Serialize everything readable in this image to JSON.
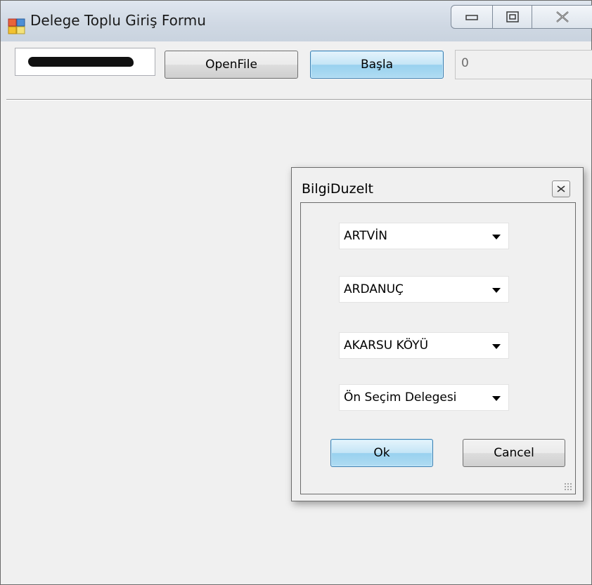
{
  "window": {
    "title": "Delege Toplu Giriş Formu",
    "icons": {
      "app": "form-app-icon",
      "minimize": "minimize-icon",
      "maximize": "maximize-icon",
      "close": "close-icon"
    }
  },
  "toolbar": {
    "id_field_value": "",
    "open_file_label": "OpenFile",
    "start_label": "Başla",
    "count_value": "0"
  },
  "dialog": {
    "title": "BilgiDuzelt",
    "combos": [
      {
        "selected": "ARTVİN"
      },
      {
        "selected": "ARDANUÇ"
      },
      {
        "selected": "AKARSU KÖYÜ"
      },
      {
        "selected": "Ön Seçim Delegesi"
      }
    ],
    "ok_label": "Ok",
    "cancel_label": "Cancel"
  },
  "colors": {
    "focus_border": "#3c7fb1",
    "window_bg": "#f0f0f0"
  }
}
